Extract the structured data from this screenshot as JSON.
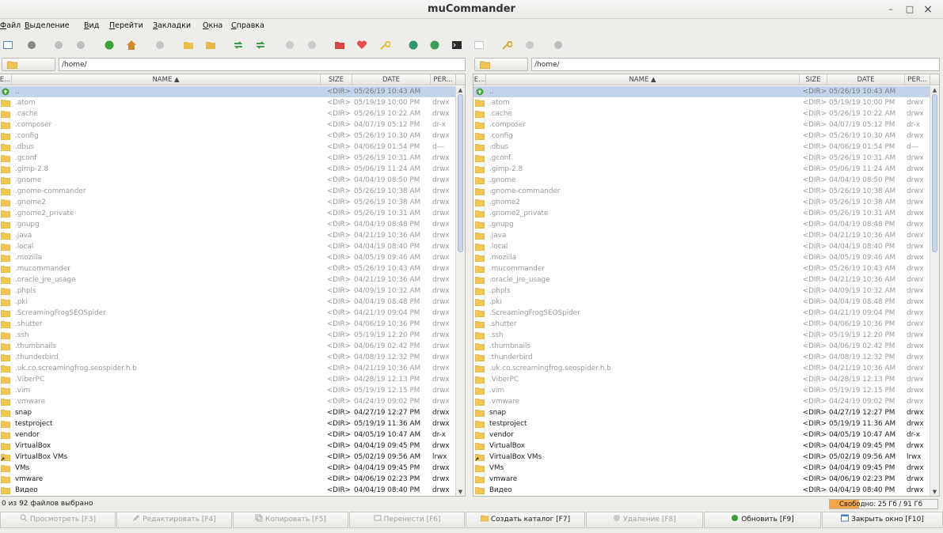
{
  "window": {
    "title": "muCommander",
    "minimize": "–",
    "maximize": "□",
    "close": "×"
  },
  "menu": [
    "Файл",
    "Выделение",
    "Вид",
    "Перейти",
    "Закладки",
    "Окна",
    "Справка"
  ],
  "toolbar": [
    {
      "icon": "new-window-icon",
      "color": "#4f8ec7"
    },
    {
      "icon": "connect-icon",
      "color": "#8a8a8a"
    },
    {
      "icon": "back-icon",
      "color": "#bdbdbd"
    },
    {
      "icon": "forward-icon",
      "color": "#bdbdbd"
    },
    {
      "icon": "parent-folder-icon",
      "color": "#3aa43a"
    },
    {
      "icon": "home-icon",
      "color": "#d08a2a"
    },
    {
      "icon": "stop-icon",
      "color": "#c4c4c4"
    },
    {
      "icon": "mark-files-icon",
      "color": "#e8c04a"
    },
    {
      "icon": "unmark-files-icon",
      "color": "#e8b84a"
    },
    {
      "icon": "swap-panels-icon",
      "color": "#3e9d4a"
    },
    {
      "icon": "sync-panels-icon",
      "color": "#3e9d4a"
    },
    {
      "icon": "disabled-icon",
      "color": "#c9c9c9"
    },
    {
      "icon": "disabled-icon",
      "color": "#c9c9c9"
    },
    {
      "icon": "pack-icon",
      "color": "#d74545"
    },
    {
      "icon": "unpack-icon",
      "color": "#e05050"
    },
    {
      "icon": "bookmark-key-icon",
      "color": "#e2c235"
    },
    {
      "icon": "network-icon",
      "color": "#2f9a6b"
    },
    {
      "icon": "globe-icon",
      "color": "#3d9c55"
    },
    {
      "icon": "terminal-icon",
      "color": "#2b2b2b"
    },
    {
      "icon": "email-icon",
      "color": "#c9c9c9"
    },
    {
      "icon": "preferences-icon",
      "color": "#d9b03a"
    },
    {
      "icon": "disabled-icon",
      "color": "#c9c9c9"
    },
    {
      "icon": "disabled-icon",
      "color": "#bcbcbc"
    }
  ],
  "left_panel": {
    "path": "/home/",
    "columns": {
      "ext": "E...",
      "name": "NAME ▲",
      "size": "SIZE",
      "date": "DATE",
      "perm": "PER..."
    }
  },
  "right_panel": {
    "path": "/home/",
    "columns": {
      "ext": "E...",
      "name": "NAME ▲",
      "size": "SIZE",
      "date": "DATE",
      "perm": "PER..."
    }
  },
  "files": [
    {
      "name": "..",
      "size": "<DIR>",
      "date": "05/26/19 10:43 AM",
      "perm": "",
      "hidden": true,
      "type": "parent"
    },
    {
      "name": ".atom",
      "size": "<DIR>",
      "date": "05/19/19 10:00 PM",
      "perm": "drwx",
      "hidden": true,
      "type": "folder"
    },
    {
      "name": ".cache",
      "size": "<DIR>",
      "date": "05/26/19 10:22 AM",
      "perm": "drwx",
      "hidden": true,
      "type": "folder"
    },
    {
      "name": ".composer",
      "size": "<DIR>",
      "date": "04/07/19 05:12 PM",
      "perm": "dr-x",
      "hidden": true,
      "type": "folder"
    },
    {
      "name": ".config",
      "size": "<DIR>",
      "date": "05/26/19 10:30 AM",
      "perm": "drwx",
      "hidden": true,
      "type": "folder"
    },
    {
      "name": ".dbus",
      "size": "<DIR>",
      "date": "04/06/19 01:54 PM",
      "perm": "d---",
      "hidden": true,
      "type": "folder"
    },
    {
      "name": ".gconf",
      "size": "<DIR>",
      "date": "05/26/19 10:31 AM",
      "perm": "drwx",
      "hidden": true,
      "type": "folder"
    },
    {
      "name": ".gimp-2.8",
      "size": "<DIR>",
      "date": "05/06/19 11:24 AM",
      "perm": "drwx",
      "hidden": true,
      "type": "folder"
    },
    {
      "name": ".gnome",
      "size": "<DIR>",
      "date": "04/04/19 08:50 PM",
      "perm": "drwx",
      "hidden": true,
      "type": "folder"
    },
    {
      "name": ".gnome-commander",
      "size": "<DIR>",
      "date": "05/26/19 10:38 AM",
      "perm": "drwx",
      "hidden": true,
      "type": "folder"
    },
    {
      "name": ".gnome2",
      "size": "<DIR>",
      "date": "05/26/19 10:38 AM",
      "perm": "drwx",
      "hidden": true,
      "type": "folder"
    },
    {
      "name": ".gnome2_private",
      "size": "<DIR>",
      "date": "05/26/19 10:31 AM",
      "perm": "drwx",
      "hidden": true,
      "type": "folder"
    },
    {
      "name": ".gnupg",
      "size": "<DIR>",
      "date": "04/04/19 08:48 PM",
      "perm": "drwx",
      "hidden": true,
      "type": "folder"
    },
    {
      "name": ".java",
      "size": "<DIR>",
      "date": "04/21/19 10:36 AM",
      "perm": "drwx",
      "hidden": true,
      "type": "folder"
    },
    {
      "name": ".local",
      "size": "<DIR>",
      "date": "04/04/19 08:40 PM",
      "perm": "drwx",
      "hidden": true,
      "type": "folder"
    },
    {
      "name": ".mozilla",
      "size": "<DIR>",
      "date": "04/05/19 09:46 AM",
      "perm": "drwx",
      "hidden": true,
      "type": "folder"
    },
    {
      "name": ".mucommander",
      "size": "<DIR>",
      "date": "05/26/19 10:43 AM",
      "perm": "drwx",
      "hidden": true,
      "type": "folder"
    },
    {
      "name": ".oracle_jre_usage",
      "size": "<DIR>",
      "date": "04/21/19 10:36 AM",
      "perm": "drwx",
      "hidden": true,
      "type": "folder"
    },
    {
      "name": ".phpls",
      "size": "<DIR>",
      "date": "04/09/19 10:32 AM",
      "perm": "drwx",
      "hidden": true,
      "type": "folder"
    },
    {
      "name": ".pki",
      "size": "<DIR>",
      "date": "04/04/19 08:48 PM",
      "perm": "drwx",
      "hidden": true,
      "type": "folder"
    },
    {
      "name": ".ScreamingFrogSEOSpider",
      "size": "<DIR>",
      "date": "04/21/19 09:04 PM",
      "perm": "drwx",
      "hidden": true,
      "type": "folder"
    },
    {
      "name": ".shutter",
      "size": "<DIR>",
      "date": "04/06/19 10:36 PM",
      "perm": "drwx",
      "hidden": true,
      "type": "folder"
    },
    {
      "name": ".ssh",
      "size": "<DIR>",
      "date": "05/19/19 12:20 PM",
      "perm": "drwx",
      "hidden": true,
      "type": "folder"
    },
    {
      "name": ".thumbnails",
      "size": "<DIR>",
      "date": "04/06/19 02:42 PM",
      "perm": "drwx",
      "hidden": true,
      "type": "folder"
    },
    {
      "name": ".thunderbird",
      "size": "<DIR>",
      "date": "04/08/19 12:32 PM",
      "perm": "drwx",
      "hidden": true,
      "type": "folder"
    },
    {
      "name": ".uk.co.screamingfrog.seospider.h.b",
      "size": "<DIR>",
      "date": "04/21/19 10:36 AM",
      "perm": "drwx",
      "hidden": true,
      "type": "folder"
    },
    {
      "name": ".ViberPC",
      "size": "<DIR>",
      "date": "04/28/19 12:13 PM",
      "perm": "drwx",
      "hidden": true,
      "type": "folder"
    },
    {
      "name": ".vim",
      "size": "<DIR>",
      "date": "05/19/19 12:15 PM",
      "perm": "drwx",
      "hidden": true,
      "type": "folder"
    },
    {
      "name": ".vmware",
      "size": "<DIR>",
      "date": "04/24/19 09:02 PM",
      "perm": "drwx",
      "hidden": true,
      "type": "folder"
    },
    {
      "name": "snap",
      "size": "<DIR>",
      "date": "04/27/19 12:27 PM",
      "perm": "drwx",
      "hidden": false,
      "type": "folder"
    },
    {
      "name": "testproject",
      "size": "<DIR>",
      "date": "05/19/19 11:36 AM",
      "perm": "drwx",
      "hidden": false,
      "type": "folder"
    },
    {
      "name": "vendor",
      "size": "<DIR>",
      "date": "04/05/19 10:47 AM",
      "perm": "dr-x",
      "hidden": false,
      "type": "folder"
    },
    {
      "name": "VirtualBox",
      "size": "<DIR>",
      "date": "04/04/19 09:45 PM",
      "perm": "drwx",
      "hidden": false,
      "type": "folder"
    },
    {
      "name": "VirtualBox VMs",
      "size": "<DIR>",
      "date": "05/02/19 09:56 AM",
      "perm": "lrwx",
      "hidden": false,
      "type": "link"
    },
    {
      "name": "VMs",
      "size": "<DIR>",
      "date": "04/04/19 09:45 PM",
      "perm": "drwx",
      "hidden": false,
      "type": "folder"
    },
    {
      "name": "vmware",
      "size": "<DIR>",
      "date": "04/06/19 02:23 PM",
      "perm": "drwx",
      "hidden": false,
      "type": "folder"
    },
    {
      "name": "Видео",
      "size": "<DIR>",
      "date": "04/04/19 08:40 PM",
      "perm": "drwx",
      "hidden": false,
      "type": "folder"
    }
  ],
  "status": {
    "selection": "0 из 92 файлов выбрано",
    "free_space": "Свободно: 25 Гб / 91 Гб",
    "free_fraction": 0.27
  },
  "fkeys": [
    {
      "label": "Просмотреть [F3]",
      "enabled": false,
      "icon": "view-icon"
    },
    {
      "label": "Редактировать [F4]",
      "enabled": false,
      "icon": "edit-icon"
    },
    {
      "label": "Копировать [F5]",
      "enabled": false,
      "icon": "copy-icon"
    },
    {
      "label": "Перенести [F6]",
      "enabled": false,
      "icon": "move-icon"
    },
    {
      "label": "Создать каталог [F7]",
      "enabled": true,
      "icon": "folder-icon"
    },
    {
      "label": "Удаление [F8]",
      "enabled": false,
      "icon": "delete-icon"
    },
    {
      "label": "Обновить [F9]",
      "enabled": true,
      "icon": "refresh-icon"
    },
    {
      "label": "Закрыть окно [F10]",
      "enabled": true,
      "icon": "close-window-icon"
    }
  ]
}
